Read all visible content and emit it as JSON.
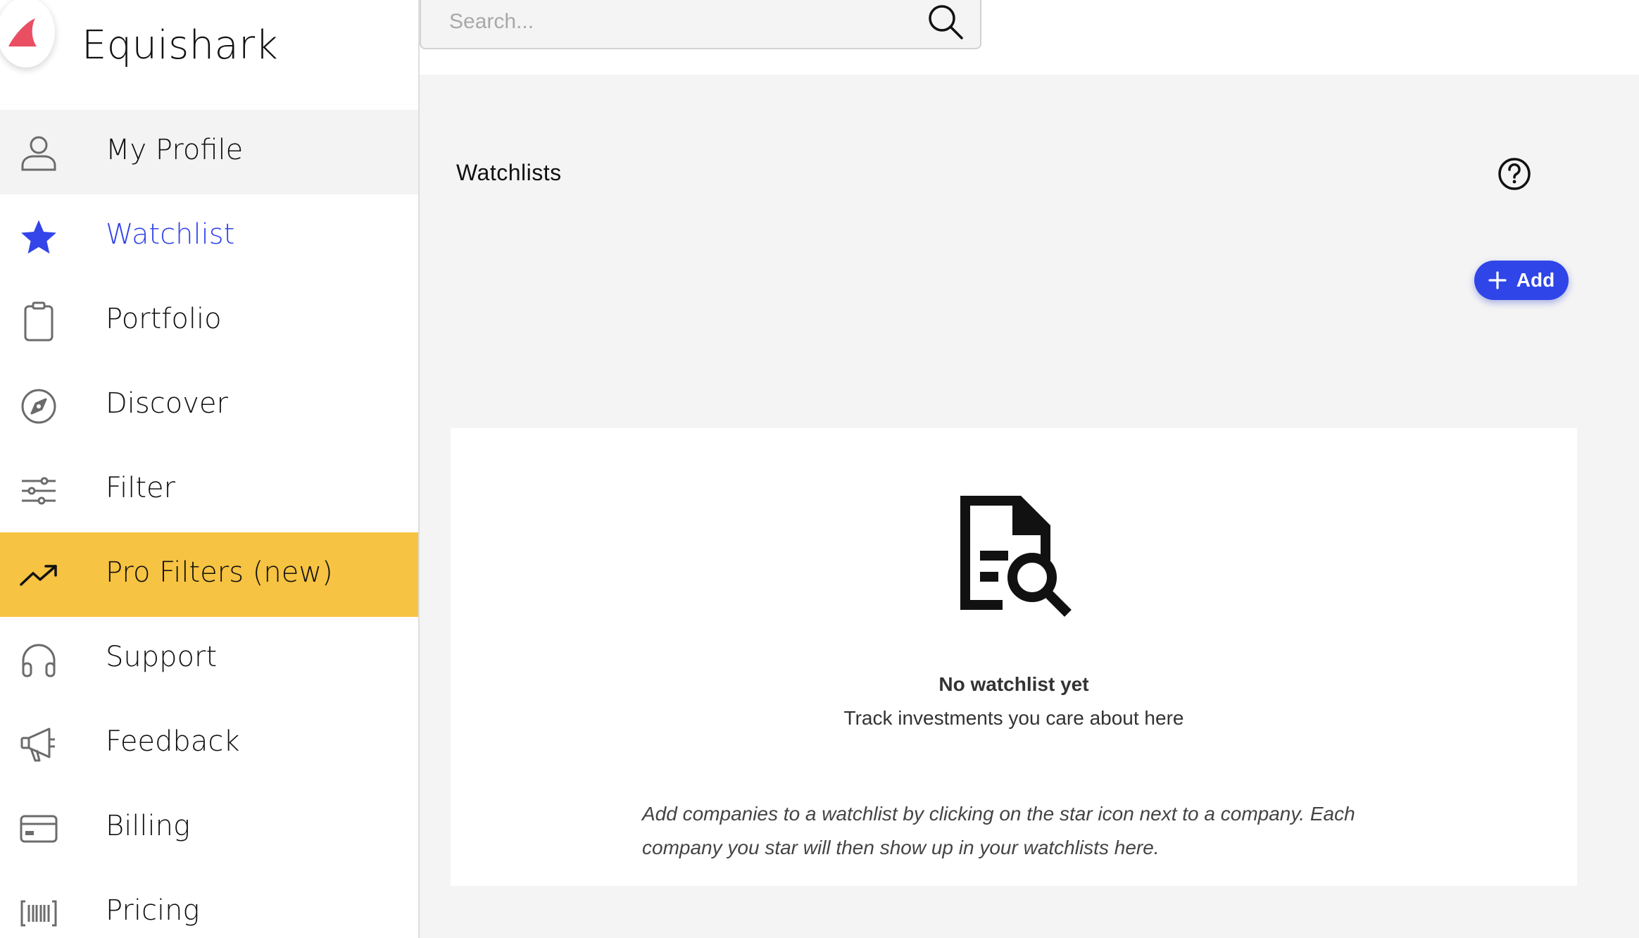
{
  "brand": {
    "name": "Equishark",
    "accent": "#e94e63"
  },
  "sidebar": {
    "items": [
      {
        "label": "My Profile",
        "icon": "user-icon",
        "state": "hover"
      },
      {
        "label": "Watchlist",
        "icon": "star-icon",
        "state": "active"
      },
      {
        "label": "Portfolio",
        "icon": "clipboard-icon",
        "state": ""
      },
      {
        "label": "Discover",
        "icon": "compass-icon",
        "state": ""
      },
      {
        "label": "Filter",
        "icon": "sliders-icon",
        "state": ""
      },
      {
        "label": "Pro Filters (new)",
        "icon": "trending-up-icon",
        "state": "highlight"
      },
      {
        "label": "Support",
        "icon": "headphones-icon",
        "state": ""
      },
      {
        "label": "Feedback",
        "icon": "megaphone-icon",
        "state": ""
      },
      {
        "label": "Billing",
        "icon": "credit-card-icon",
        "state": ""
      },
      {
        "label": "Pricing",
        "icon": "barcode-icon",
        "state": ""
      }
    ],
    "active_color": "#3344e8",
    "highlight_color": "#f6c342"
  },
  "search": {
    "placeholder": "Search...",
    "value": ""
  },
  "main": {
    "title": "Watchlists",
    "add_label": "Add",
    "empty": {
      "icon": "document-search-icon",
      "title": "No watchlist yet",
      "subtitle": "Track investments you care about here",
      "note": "Add companies to a watchlist by clicking on the star icon next to a company. Each company you star will then show up in your watchlists here."
    }
  }
}
